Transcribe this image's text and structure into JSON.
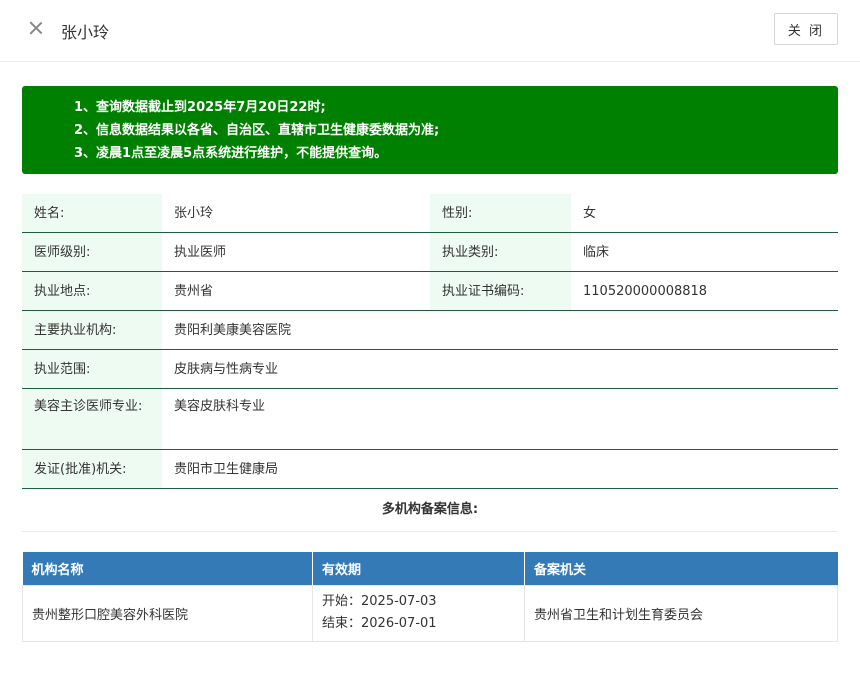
{
  "header": {
    "title": "张小玲",
    "close_label": "关 闭"
  },
  "notice": {
    "lines": [
      "1、查询数据截止到2025年7月20日22时;",
      "2、信息数据结果以各省、自治区、直辖市卫生健康委数据为准;",
      "3、凌晨1点至凌晨5点系统进行维护，不能提供查询。"
    ]
  },
  "info": {
    "name_label": "姓名:",
    "name_value": "张小玲",
    "gender_label": "性别:",
    "gender_value": "女",
    "level_label": "医师级别:",
    "level_value": "执业医师",
    "category_label": "执业类别:",
    "category_value": "临床",
    "location_label": "执业地点:",
    "location_value": "贵州省",
    "cert_label": "执业证书编码:",
    "cert_value": "110520000008818",
    "institution_label": "主要执业机构:",
    "institution_value": "贵阳利美康美容医院",
    "scope_label": "执业范围:",
    "scope_value": "皮肤病与性病专业",
    "cosmetic_label": "美容主诊医师专业:",
    "cosmetic_value": "美容皮肤科专业",
    "issuer_label": "发证(批准)机关:",
    "issuer_value": "贵阳市卫生健康局"
  },
  "multi": {
    "title": "多机构备案信息:",
    "headers": [
      "机构名称",
      "有效期",
      "备案机关"
    ],
    "rows": [
      {
        "name": "贵州整形口腔美容外科医院",
        "start": "开始：2025-07-03",
        "end": "结束：2026-07-01",
        "authority": "贵州省卫生和计划生育委员会"
      }
    ]
  }
}
